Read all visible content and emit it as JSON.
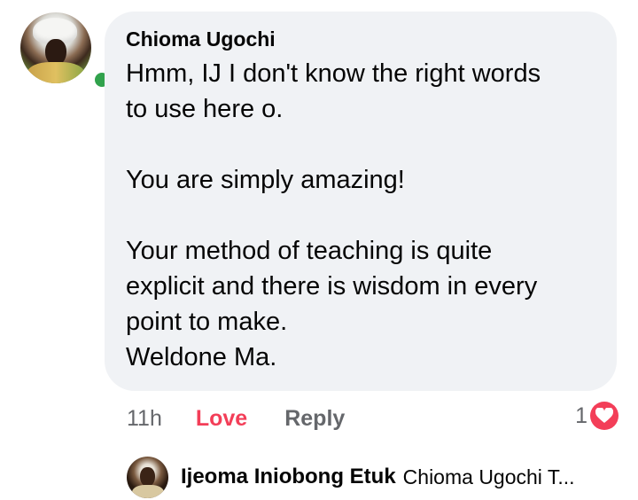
{
  "comment": {
    "author": "Chioma Ugochi",
    "text": "Hmm, IJ I don't know the right words\nto use here o.\n\nYou are simply amazing!\n\nYour method of teaching is quite\nexplicit and there is wisdom in every\npoint to make.\nWeldone Ma.",
    "avatar_icon": "user-avatar-photo",
    "online_status_icon": "online-dot-icon",
    "online_color": "#31a24c"
  },
  "actions": {
    "timestamp": "11h",
    "love_label": "Love",
    "reply_label": "Reply"
  },
  "reactions": {
    "count": "1",
    "icon": "heart-icon",
    "color": "#f33e58"
  },
  "reply_preview": {
    "author": "Ijeoma Iniobong Etuk",
    "snippet": "Chioma Ugochi T...",
    "avatar_icon": "user-avatar-photo"
  }
}
